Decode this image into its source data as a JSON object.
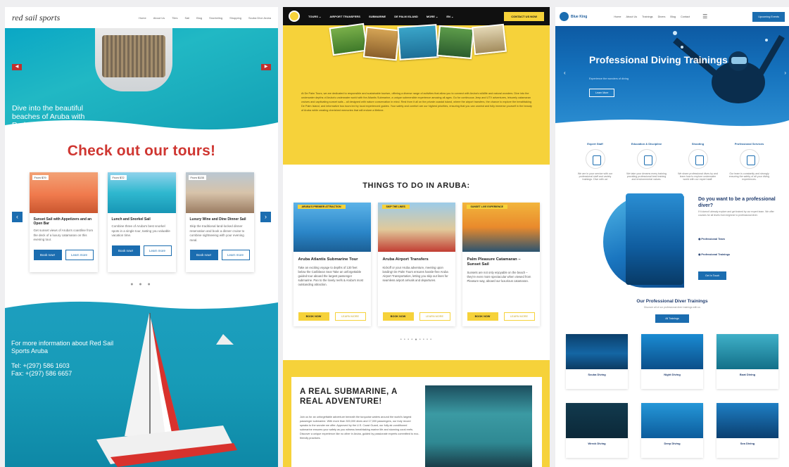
{
  "redsail": {
    "logo": "red sail sports",
    "nav": [
      "Home",
      "About Us",
      "Tiles",
      "Sail",
      "Blog",
      "Snorkeling",
      "Shopping",
      "Scuba Dive Aruba"
    ],
    "hero_text": "Dive into the beautiful beaches of Aruba with Red Sail Sports",
    "section_title": "Check out our tours!",
    "cards": [
      {
        "tag": "From $79",
        "title": "Sunset Sail with Appetizers and an Open Bar",
        "desc": "Get sunset views of Aruba's coastline from the deck of a luxury catamaran on this evening tour.",
        "btn1": "Book now!",
        "btn2": "Learn more"
      },
      {
        "tag": "From $72",
        "title": "Lunch and Snorkel Sail",
        "desc": "Combine three of Aruba's best snorkel spots in a single tour, tasting you valuable vacation time.",
        "btn1": "Book now!",
        "btn2": "Learn more"
      },
      {
        "tag": "From $135",
        "title": "Luxury Wine and Dine Dinner Sail",
        "desc": "Skip the traditional land-locked dinner reservation and book a dinner cruise to combine sightseeing with your evening meal.",
        "btn1": "Book now!",
        "btn2": "Learn more"
      }
    ],
    "dots": "● ● ●",
    "info_text": "For more information about Red Sail Sports Aruba",
    "tel": "Tel: +(297) 586 1603",
    "fax": "Fax: +(297) 586 6657"
  },
  "aruba": {
    "nav": [
      "TOURS ⌄",
      "AIRPORT TRANSFERS",
      "SUBMARINE",
      "DE PALM ISLAND",
      "MORE ⌄",
      "EN ⌄"
    ],
    "cta": "CONTACT US NOW",
    "intro": "At De Palm Tours, we are dedicated to responsible and sustainable tourism, offering a diverse range of activities that allow you to connect with Aruba's wildlife and natural wonders. Dive into the underwater depths of Aruba's underwater world with the Atlantis Submarine, a unique submersible experience amazing all ages. Go for continuous Jeep and UTV adventures, leisurely catamaran cruises and captivating sunset sails – all designed with nature conservation in mind. Rest from it all on the private coastal island, where the airport transfers, the chance to explore the breathtaking De Palm Island, and informative bus tours led by local experienced guides. Your safety and comfort are our highest priorities, ensuring that you can unwind and fully immerse yourself in the beauty of Aruba while creating cherished memories that will endure a lifetime.",
    "things_title": "THINGS TO DO IN ARUBA:",
    "cards": [
      {
        "ribbon": "ARUBA'S PREMIER ATTRACTION",
        "title": "Aruba Atlantis Submarine Tour",
        "desc": "Take an exciting voyage to depths of 130 feet below the Caribbean Sea! Take an unforgettable guided tour aboard the largest passenger submarine. Pan to the lovely reefs & Aruba's most outstanding attraction.",
        "btn1": "BOOK NOW",
        "btn2": "LEARN MORE"
      },
      {
        "ribbon": "SKIP THE LINES",
        "title": "Aruba Airport Transfers",
        "desc": "Kickoff or your Aruba adventure, meeting upon landing! De Palm Tours ensures hassle-free Aruba Airport Transportation, letting you skip out lines for seamless airport arrivals and departures.",
        "btn1": "BOOK NOW",
        "btn2": "LEARN MORE"
      },
      {
        "ribbon": "SUNSET LIVE EXPERIENCE",
        "title": "Palm Pleasure Catamaran – Sunset Sail",
        "desc": "Sunsets are not only enjoyable on the beach – they're even more spectacular when viewed from Pleasure way, aboard our luxurious catamaran.",
        "btn1": "BOOK NOW",
        "btn2": "LEARN MORE"
      }
    ],
    "dots": "• • • • ● • • • •",
    "sub_title": "A REAL SUBMARINE, A REAL ADVENTURE!",
    "sub_desc": "Join us for an unforgettable adventure beneath the turquoise waters around the world's largest passenger submarine. With more than 300,000 dives and 17,000 passengers, our truly record speaks to the wonder we offer. Approved by the U.S. Coast Guard, our fully air-conditioned submarine ensures your safety as you witness breathtaking marine life and stunning coral reefs. Discover a unique experience like no other in Aruba, guided by passionate experts committed to eco-friendly practices."
  },
  "diving": {
    "logo": "Blue King",
    "nav": [
      "Home",
      "About Us",
      "Trainings",
      "Divers",
      "Blog",
      "Contact"
    ],
    "cta": "Upcoming Events",
    "hero_title": "Professional Diving Trainings",
    "hero_sub": "Experience the wonders of diving",
    "hero_btn": "Learn More",
    "features": [
      {
        "title": "Expert Staff",
        "desc": "We are in your service with our professional staff and variety trainings. Dive with us!"
      },
      {
        "title": "Education & Discipline",
        "desc": "We take your dreams every training providing professional best training and environmental values."
      },
      {
        "title": "Shooting",
        "desc": "We share professional dives by and learn how to explore underwater world with our expert staff."
      },
      {
        "title": "Professional Services",
        "desc": "Our team is constantly and strongly ensuring the safety of all your diving experiences."
      }
    ],
    "pro_title": "Do you want to be a professional diver?",
    "pro_desc": "If it doesn't already explore and get trained by our expert team. We offer courses for all levels from beginner to professional diver.",
    "pro_items": [
      "Professional Team",
      "Professional Trainings"
    ],
    "pro_btn": "Get In Touch",
    "trainings_title": "Our Professional Diver Trainings",
    "trainings_sub": "Discover all of our professional diver trainings with us",
    "trainings_btn": "All Trainings",
    "grid": [
      "Scuba Diving",
      "Night Diving",
      "Boat Diving",
      "Wreck Diving",
      "Deep Diving",
      "Sea Diving"
    ]
  }
}
